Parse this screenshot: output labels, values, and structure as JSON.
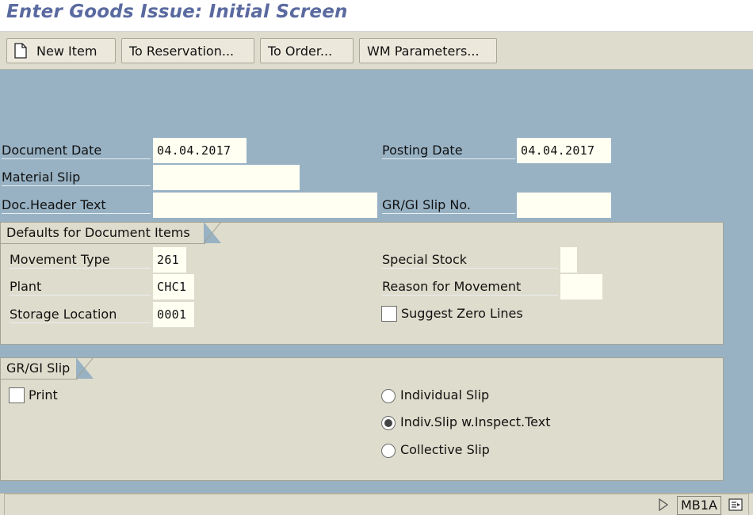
{
  "screen": {
    "title": "Enter Goods Issue: Initial Screen"
  },
  "toolbar": {
    "new_item_label": "New Item",
    "to_reservation_label": "To Reservation...",
    "to_order_label": "To Order...",
    "wm_parameters_label": "WM Parameters..."
  },
  "header": {
    "document_date_label": "Document Date",
    "document_date_value": "04.04.2017",
    "posting_date_label": "Posting Date",
    "posting_date_value": "04.04.2017",
    "material_slip_label": "Material Slip",
    "material_slip_value": "",
    "doc_header_text_label": "Doc.Header Text",
    "doc_header_text_value": "",
    "grgi_slip_no_label": "GR/GI Slip No.",
    "grgi_slip_no_value": ""
  },
  "defaults": {
    "title": "Defaults for Document Items",
    "movement_type_label": "Movement Type",
    "movement_type_value": "261",
    "plant_label": "Plant",
    "plant_value": "CHC1",
    "storage_location_label": "Storage Location",
    "storage_location_value": "0001",
    "special_stock_label": "Special Stock",
    "special_stock_value": "",
    "reason_for_movement_label": "Reason for Movement",
    "reason_for_movement_value": "",
    "suggest_zero_lines_label": "Suggest Zero Lines",
    "suggest_zero_lines_checked": false
  },
  "grgi_slip": {
    "title": "GR/GI Slip",
    "print_label": "Print",
    "print_checked": false,
    "options": [
      {
        "label": "Individual Slip",
        "selected": false
      },
      {
        "label": "Indiv.Slip w.Inspect.Text",
        "selected": true
      },
      {
        "label": "Collective Slip",
        "selected": false
      }
    ]
  },
  "status_bar": {
    "transaction_code": "MB1A"
  }
}
